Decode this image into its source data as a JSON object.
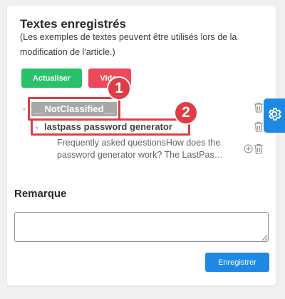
{
  "panel": {
    "title": "Textes enregistrés",
    "description": "(Les exemples de textes peuvent être utilisés lors de la modification de l'article.)",
    "buttons": {
      "update_label": "Actualiser",
      "clear_label": "Vider"
    }
  },
  "tree": {
    "category_label": "__NotClassified__",
    "item_label": "lastpass password generator",
    "item_excerpt_line1": "Frequently asked questionsHow does the",
    "item_excerpt_line2": "password generator work? The LastPas…"
  },
  "annotations": {
    "badge1": "1",
    "badge2": "2",
    "color": "#e03c45"
  },
  "remark": {
    "title": "Remarque",
    "value": ""
  },
  "footer": {
    "save_label": "Enregistrer"
  },
  "colors": {
    "accent_blue": "#1e88e5",
    "green": "#29c16a",
    "red": "#f0485a"
  },
  "icons": [
    "trash-icon",
    "plus-circle-icon",
    "gear-icon"
  ]
}
